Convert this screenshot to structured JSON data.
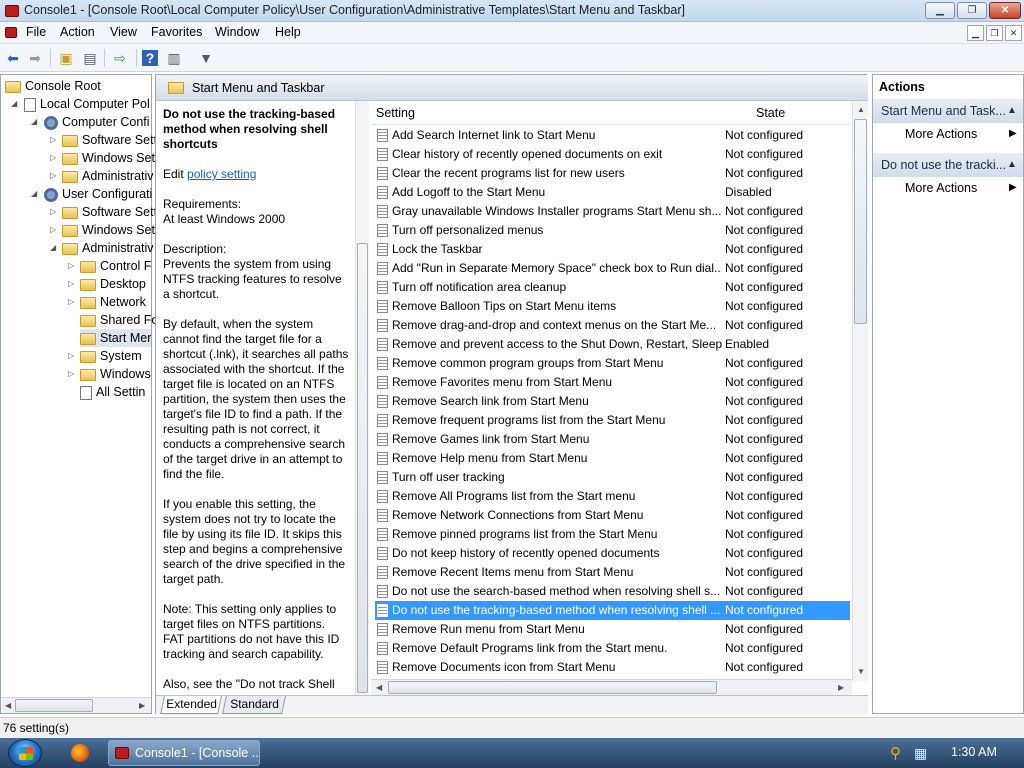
{
  "window": {
    "title": "Console1 - [Console Root\\Local Computer Policy\\User Configuration\\Administrative Templates\\Start Menu and Taskbar]"
  },
  "menu": {
    "items": [
      "File",
      "Action",
      "View",
      "Favorites",
      "Window",
      "Help"
    ]
  },
  "tree": {
    "nodes": [
      {
        "label": "Console Root"
      },
      {
        "label": "Local Computer Pol"
      },
      {
        "label": "Computer Confi"
      },
      {
        "label": "Software Sett"
      },
      {
        "label": "Windows Set"
      },
      {
        "label": "Administrativ"
      },
      {
        "label": "User Configurati"
      },
      {
        "label": "Software Sett"
      },
      {
        "label": "Windows Set"
      },
      {
        "label": "Administrativ"
      },
      {
        "label": "Control F"
      },
      {
        "label": "Desktop"
      },
      {
        "label": "Network"
      },
      {
        "label": "Shared Fo"
      },
      {
        "label": "Start Mer"
      },
      {
        "label": "System"
      },
      {
        "label": "Windows"
      },
      {
        "label": "All Settin"
      }
    ]
  },
  "content": {
    "header": "Start Menu and Taskbar",
    "policy_title": "Do not use the tracking-based method when resolving shell shortcuts",
    "edit_prefix": "Edit",
    "edit_link": "policy setting",
    "requirements_label": "Requirements:",
    "requirements_value": "At least Windows 2000",
    "description_label": "Description:",
    "description_1": "Prevents the system from using NTFS tracking features to resolve a shortcut.",
    "description_2": "By default, when the system cannot find the target file for a shortcut (.lnk), it searches all paths associated with the shortcut. If the target file is located on an NTFS partition, the system then uses the target's file ID to find a path. If the resulting path is not correct, it conducts a comprehensive search of the target drive in an attempt to find the file.",
    "description_3": "If you enable this setting, the system does not try to locate the file by using its file ID. It skips this step and begins a comprehensive search of the drive specified in the target path.",
    "description_4": "Note: This setting only applies to target files on NTFS partitions. FAT partitions do not have this ID tracking and search capability.",
    "description_5": "Also, see the \"Do not track Shell",
    "tabs": [
      "Extended",
      "Standard"
    ]
  },
  "list": {
    "columns": {
      "setting": "Setting",
      "state": "State"
    },
    "rows": [
      {
        "name": "Add Search Internet link to Start Menu",
        "state": "Not configured"
      },
      {
        "name": "Clear history of recently opened documents on exit",
        "state": "Not configured"
      },
      {
        "name": "Clear the recent programs list for new users",
        "state": "Not configured"
      },
      {
        "name": "Add Logoff to the Start Menu",
        "state": "Disabled"
      },
      {
        "name": "Gray unavailable Windows Installer programs Start Menu sh...",
        "state": "Not configured"
      },
      {
        "name": "Turn off personalized menus",
        "state": "Not configured"
      },
      {
        "name": "Lock the Taskbar",
        "state": "Not configured"
      },
      {
        "name": "Add \"Run in Separate Memory Space\" check box to Run dial...",
        "state": "Not configured"
      },
      {
        "name": "Turn off notification area cleanup",
        "state": "Not configured"
      },
      {
        "name": "Remove Balloon Tips on Start Menu items",
        "state": "Not configured"
      },
      {
        "name": "Remove drag-and-drop and context menus on the Start Me...",
        "state": "Not configured"
      },
      {
        "name": "Remove and prevent access to the Shut Down, Restart, Sleep...",
        "state": "Enabled"
      },
      {
        "name": "Remove common program groups from Start Menu",
        "state": "Not configured"
      },
      {
        "name": "Remove Favorites menu from Start Menu",
        "state": "Not configured"
      },
      {
        "name": "Remove Search link from Start Menu",
        "state": "Not configured"
      },
      {
        "name": "Remove frequent programs list from the Start Menu",
        "state": "Not configured"
      },
      {
        "name": "Remove Games link from Start Menu",
        "state": "Not configured"
      },
      {
        "name": "Remove Help menu from Start Menu",
        "state": "Not configured"
      },
      {
        "name": "Turn off user tracking",
        "state": "Not configured"
      },
      {
        "name": "Remove All Programs list from the Start menu",
        "state": "Not configured"
      },
      {
        "name": "Remove Network Connections from Start Menu",
        "state": "Not configured"
      },
      {
        "name": "Remove pinned programs list from the Start Menu",
        "state": "Not configured"
      },
      {
        "name": "Do not keep history of recently opened documents",
        "state": "Not configured"
      },
      {
        "name": "Remove Recent Items menu from Start Menu",
        "state": "Not configured"
      },
      {
        "name": "Do not use the search-based method when resolving shell s...",
        "state": "Not configured"
      },
      {
        "name": "Do not use the tracking-based method when resolving shell ...",
        "state": "Not configured"
      },
      {
        "name": "Remove Run menu from Start Menu",
        "state": "Not configured"
      },
      {
        "name": "Remove Default Programs link from the Start menu.",
        "state": "Not configured"
      },
      {
        "name": "Remove Documents icon from Start Menu",
        "state": "Not configured"
      }
    ],
    "selected_index": 25
  },
  "actions": {
    "title": "Actions",
    "section_1": "Start Menu and Task...",
    "section_1_item": "More Actions",
    "section_2": "Do not use the tracki...",
    "section_2_item": "More Actions"
  },
  "status": {
    "text": "76 setting(s)"
  },
  "taskbar": {
    "window_button": "Console1 - [Console ...",
    "clock": "1:30 AM"
  }
}
